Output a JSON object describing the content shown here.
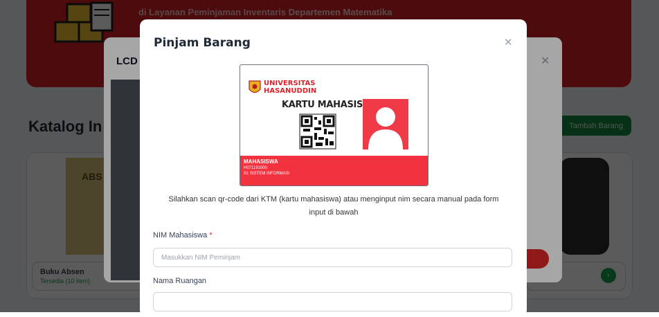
{
  "background": {
    "banner_text_prefix": "di Layanan Peminjaman Inventaris",
    "banner_text_dept": "Departemen Matematika",
    "heading": "Katalog In",
    "add_button": "Tambah Barang",
    "card": {
      "image_text": "ABS",
      "title": "Buku Absen",
      "status": "Tersedia (10 item)"
    },
    "colors": {
      "banner": "#dc1f26",
      "add_button": "#158a43"
    }
  },
  "back_modal": {
    "title": "LCD",
    "close_icon": "close-icon"
  },
  "modal": {
    "title": "Pinjam Barang",
    "close_icon": "close-icon",
    "card": {
      "university_line1": "UNIVERSITAS",
      "university_line2": "HASANUDDIN",
      "card_type": "KARTU MAHASISWA",
      "role": "MAHASISWA",
      "nim": "H071191000",
      "prodi": "S1 SISTEM INFORMASI",
      "accent_color": "#f2323f"
    },
    "instruction": "Silahkan scan qr-code dari KTM (kartu mahasiswa) atau menginput nim secara manual pada form input di bawah",
    "fields": {
      "nim_label": "NIM Mahasiswa",
      "nim_required": "*",
      "nim_placeholder": "Masukkan NIM Peminjam",
      "nim_value": "",
      "room_label": "Nama Ruangan",
      "room_value": ""
    }
  }
}
